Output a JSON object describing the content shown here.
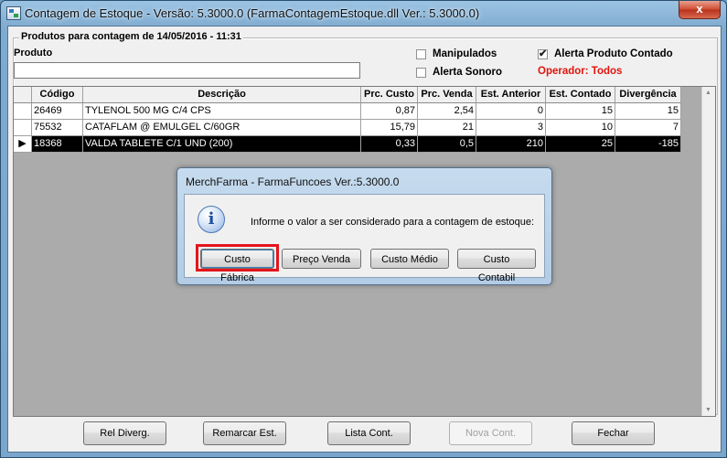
{
  "window": {
    "title": "Contagem de Estoque - Versão: 5.3000.0 (FarmaContagemEstoque.dll Ver.: 5.3000.0)",
    "close_symbol": "x"
  },
  "group": {
    "legend": "Produtos para contagem de 14/05/2016 - 11:31",
    "produto_label": "Produto",
    "produto_value": ""
  },
  "options": {
    "manipulados": {
      "label": "Manipulados",
      "checked": false
    },
    "alerta_produto": {
      "label": "Alerta Produto Contado",
      "checked": true
    },
    "alerta_sonoro": {
      "label": "Alerta Sonoro",
      "checked": false
    },
    "operador": "Operador: Todos"
  },
  "grid": {
    "columns": [
      "Código",
      "Descrição",
      "Prc. Custo",
      "Prc. Venda",
      "Est. Anterior",
      "Est. Contado",
      "Divergência"
    ],
    "rows": [
      {
        "codigo": "26469",
        "descricao": "TYLENOL 500 MG C/4 CPS",
        "custo": "0,87",
        "venda": "2,54",
        "anterior": "0",
        "contado": "15",
        "divergencia": "15",
        "selected": false
      },
      {
        "codigo": "75532",
        "descricao": "CATAFLAM @ EMULGEL C/60GR",
        "custo": "15,79",
        "venda": "21",
        "anterior": "3",
        "contado": "10",
        "divergencia": "7",
        "selected": false
      },
      {
        "codigo": "18368",
        "descricao": "VALDA TABLETE C/1 UND (200)",
        "custo": "0,33",
        "venda": "0,5",
        "anterior": "210",
        "contado": "25",
        "divergencia": "-185",
        "selected": true
      }
    ],
    "row_indicator": "▶"
  },
  "dialog": {
    "title": "MerchFarma - FarmaFuncoes  Ver.:5.3000.0",
    "message": "Informe o valor a ser considerado para a contagem de estoque:",
    "icon_letter": "i",
    "buttons": [
      "Custo Fábrica",
      "Preço Venda",
      "Custo Médio",
      "Custo Contabil"
    ]
  },
  "footer_buttons": {
    "rel_diverg": "Rel Diverg.",
    "remarcar": "Remarcar Est.",
    "lista": "Lista Cont.",
    "nova": "Nova Cont.",
    "fechar": "Fechar"
  }
}
